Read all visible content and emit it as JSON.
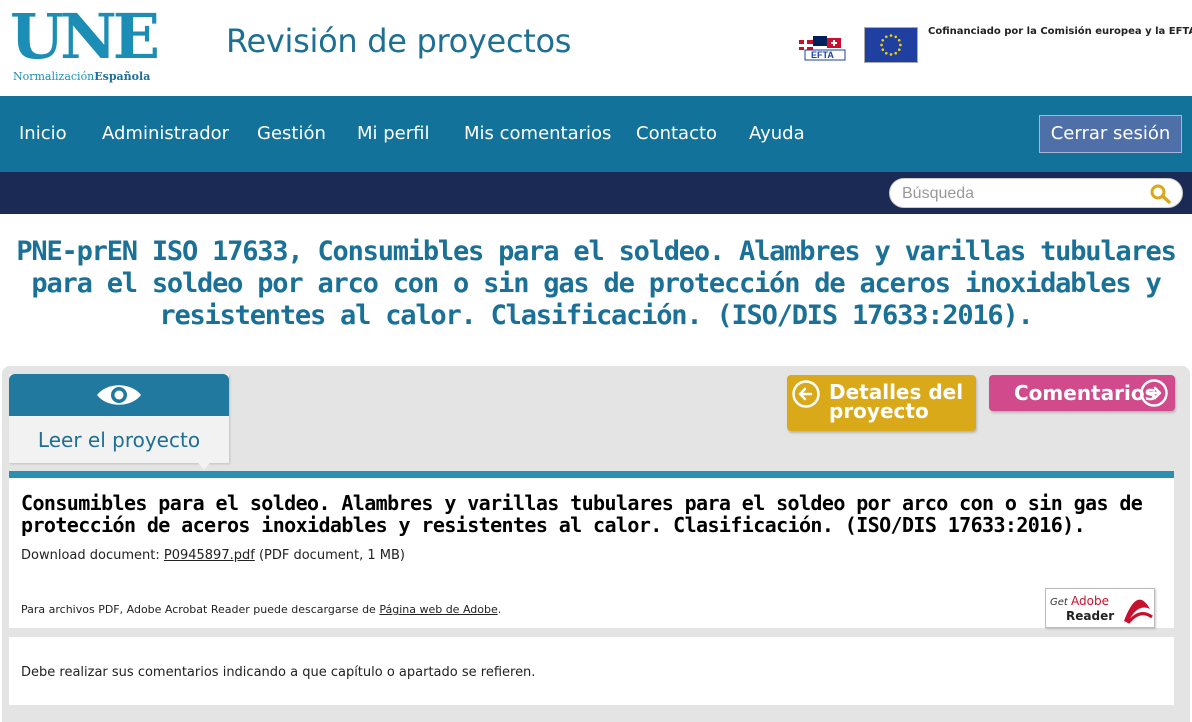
{
  "header": {
    "logo_mark": "UNE",
    "logo_sub_1": "Normalización",
    "logo_sub_2": "Española",
    "site_title": "Revisión de proyectos",
    "efta_label": "EFTA",
    "cofinance_text": "Cofinanciado por la Comisión europea y la EFTA"
  },
  "nav": {
    "items": [
      "Inicio",
      "Administrador",
      "Gestión",
      "Mi perfil",
      "Mis comentarios",
      "Contacto",
      "Ayuda"
    ],
    "logout_label": "Cerrar sesión"
  },
  "search": {
    "placeholder": "Búsqueda"
  },
  "page": {
    "title": "PNE-prEN ISO 17633, Consumibles para el soldeo. Alambres y varillas tubulares para el soldeo por arco con o sin gas de protección de aceros inoxidables y resistentes al calor. Clasificación. (ISO/DIS 17633:2016)."
  },
  "tabs": {
    "read_label": "Leer el proyecto",
    "details_label": "Detalles del proyecto",
    "comments_label": "Comentarios"
  },
  "document": {
    "title": "Consumibles para el soldeo. Alambres y varillas tubulares para el soldeo por arco con o sin gas de protección de aceros inoxidables y resistentes al calor. Clasificación. (ISO/DIS 17633:2016).",
    "download_prefix": "Download document: ",
    "file_name": "P0945897.pdf",
    "file_info": " (PDF document, 1 MB)",
    "adobe_prefix": "Para archivos PDF, Adobe Acrobat Reader puede descargarse de ",
    "adobe_link": "Página web de Adobe",
    "adobe_suffix": ".",
    "badge_get": "Get",
    "badge_brand": "Adobe",
    "badge_reader": "Reader"
  },
  "note": {
    "text": "Debe realizar sus comentarios indicando a que capítulo o apartado se refieren."
  },
  "colors": {
    "brand_blue": "#13729a",
    "dark_navy": "#1b2a55",
    "details_gold": "#d9a91a",
    "comments_pink": "#d14a8c"
  }
}
